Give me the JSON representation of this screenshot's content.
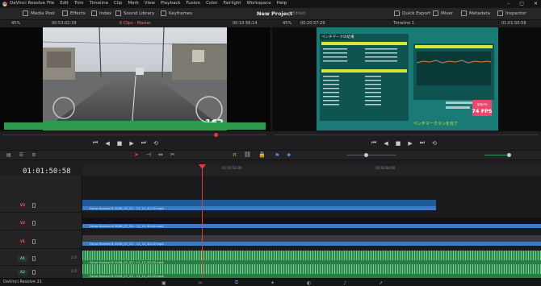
{
  "app": {
    "name": "DaVinci Resolve",
    "version_label": "DaVinci Resolve 21"
  },
  "menu": [
    "File",
    "Edit",
    "Trim",
    "Timeline",
    "Clip",
    "Mark",
    "View",
    "Playback",
    "Fusion",
    "Color",
    "Fairlight",
    "Workspace",
    "Help"
  ],
  "toolbar": {
    "media_pool": "Media Pool",
    "effects": "Effects",
    "index": "Index",
    "sound_library": "Sound Library",
    "keyframes": "Keyframes",
    "project_title": "New Project",
    "project_status": "Edited",
    "quick_export": "Quick Export",
    "mixer": "Mixer",
    "metadata": "Metadata",
    "inspector": "Inspector"
  },
  "source_viewer": {
    "zoom": "45%",
    "timecode": "00:53:02:39",
    "title": "6 Clips - Master",
    "duration": "00:10:56:14",
    "speedo": "162",
    "progress": 0.82
  },
  "program_viewer": {
    "zoom": "45%",
    "timecode": "00:20:57:29",
    "timeline_name": "Timeline 1",
    "current_tc": "01:01:50:58",
    "benchmark_header": "ベンチマークの結果",
    "fps_value": "74 FPS",
    "fps_label": "平均FPS",
    "footer_text": "ベンチマークランを完了"
  },
  "timeline": {
    "big_timecode": "01:01:50:58",
    "ruler_labels": [
      "01:01:52:00",
      "01:02:04:00"
    ],
    "tracks": [
      {
        "id": "V3",
        "type": "video"
      },
      {
        "id": "V2",
        "type": "video"
      },
      {
        "id": "V1",
        "type": "video"
      },
      {
        "id": "A1",
        "type": "audio",
        "level": "2.0"
      },
      {
        "id": "A2",
        "type": "audio",
        "level": "2.0"
      }
    ],
    "clip_name": "Forza Horizon 6 2026_07_22 - 11_12_42.02.mp4"
  },
  "colors": {
    "playhead": "#e23b3b",
    "video_clip": "#2c64a8",
    "audio_clip": "#2c8a4c",
    "teal": "#1a7f7a"
  }
}
